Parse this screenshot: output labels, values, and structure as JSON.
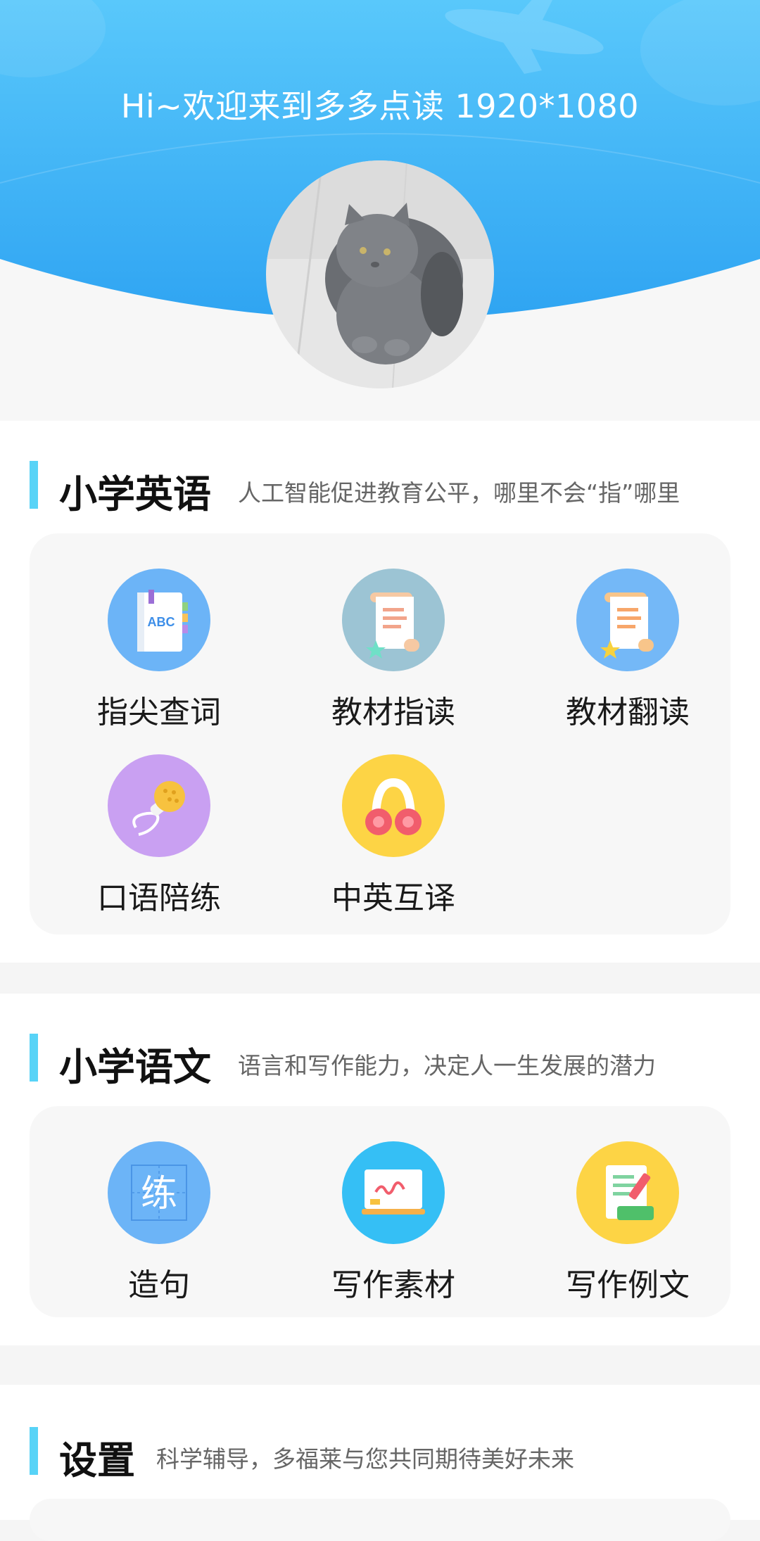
{
  "header": {
    "greeting": "Hi~欢迎来到多多点读 1920*1080"
  },
  "sections": {
    "english": {
      "title": "小学英语",
      "subtitle": "人工智能促进教育公平，哪里不会“指”哪里",
      "items": [
        {
          "label": "指尖查词",
          "icon": "abc-book-icon",
          "color": "#6cb4f7"
        },
        {
          "label": "教材指读",
          "icon": "scroll-icon",
          "color": "#9cc4d4"
        },
        {
          "label": "教材翻读",
          "icon": "scroll-icon",
          "color": "#74b8f7"
        },
        {
          "label": "口语陪练",
          "icon": "microphone-icon",
          "color": "#c9a0f2"
        },
        {
          "label": "中英互译",
          "icon": "headphones-icon",
          "color": "#fdd445"
        }
      ]
    },
    "chinese": {
      "title": "小学语文",
      "subtitle": "语言和写作能力，决定人一生发展的潜力",
      "items": [
        {
          "label": "造句",
          "icon": "practice-character-icon",
          "color": "#6cb4f7"
        },
        {
          "label": "写作素材",
          "icon": "whiteboard-icon",
          "color": "#35bff5"
        },
        {
          "label": "写作例文",
          "icon": "note-pencil-icon",
          "color": "#fdd445"
        }
      ]
    },
    "settings": {
      "title": "设置",
      "subtitle": "科学辅导，多福莱与您共同期待美好未来"
    }
  },
  "colors": {
    "accent_bar": "#58d3f7",
    "header_blue": "#3fb1f5"
  }
}
